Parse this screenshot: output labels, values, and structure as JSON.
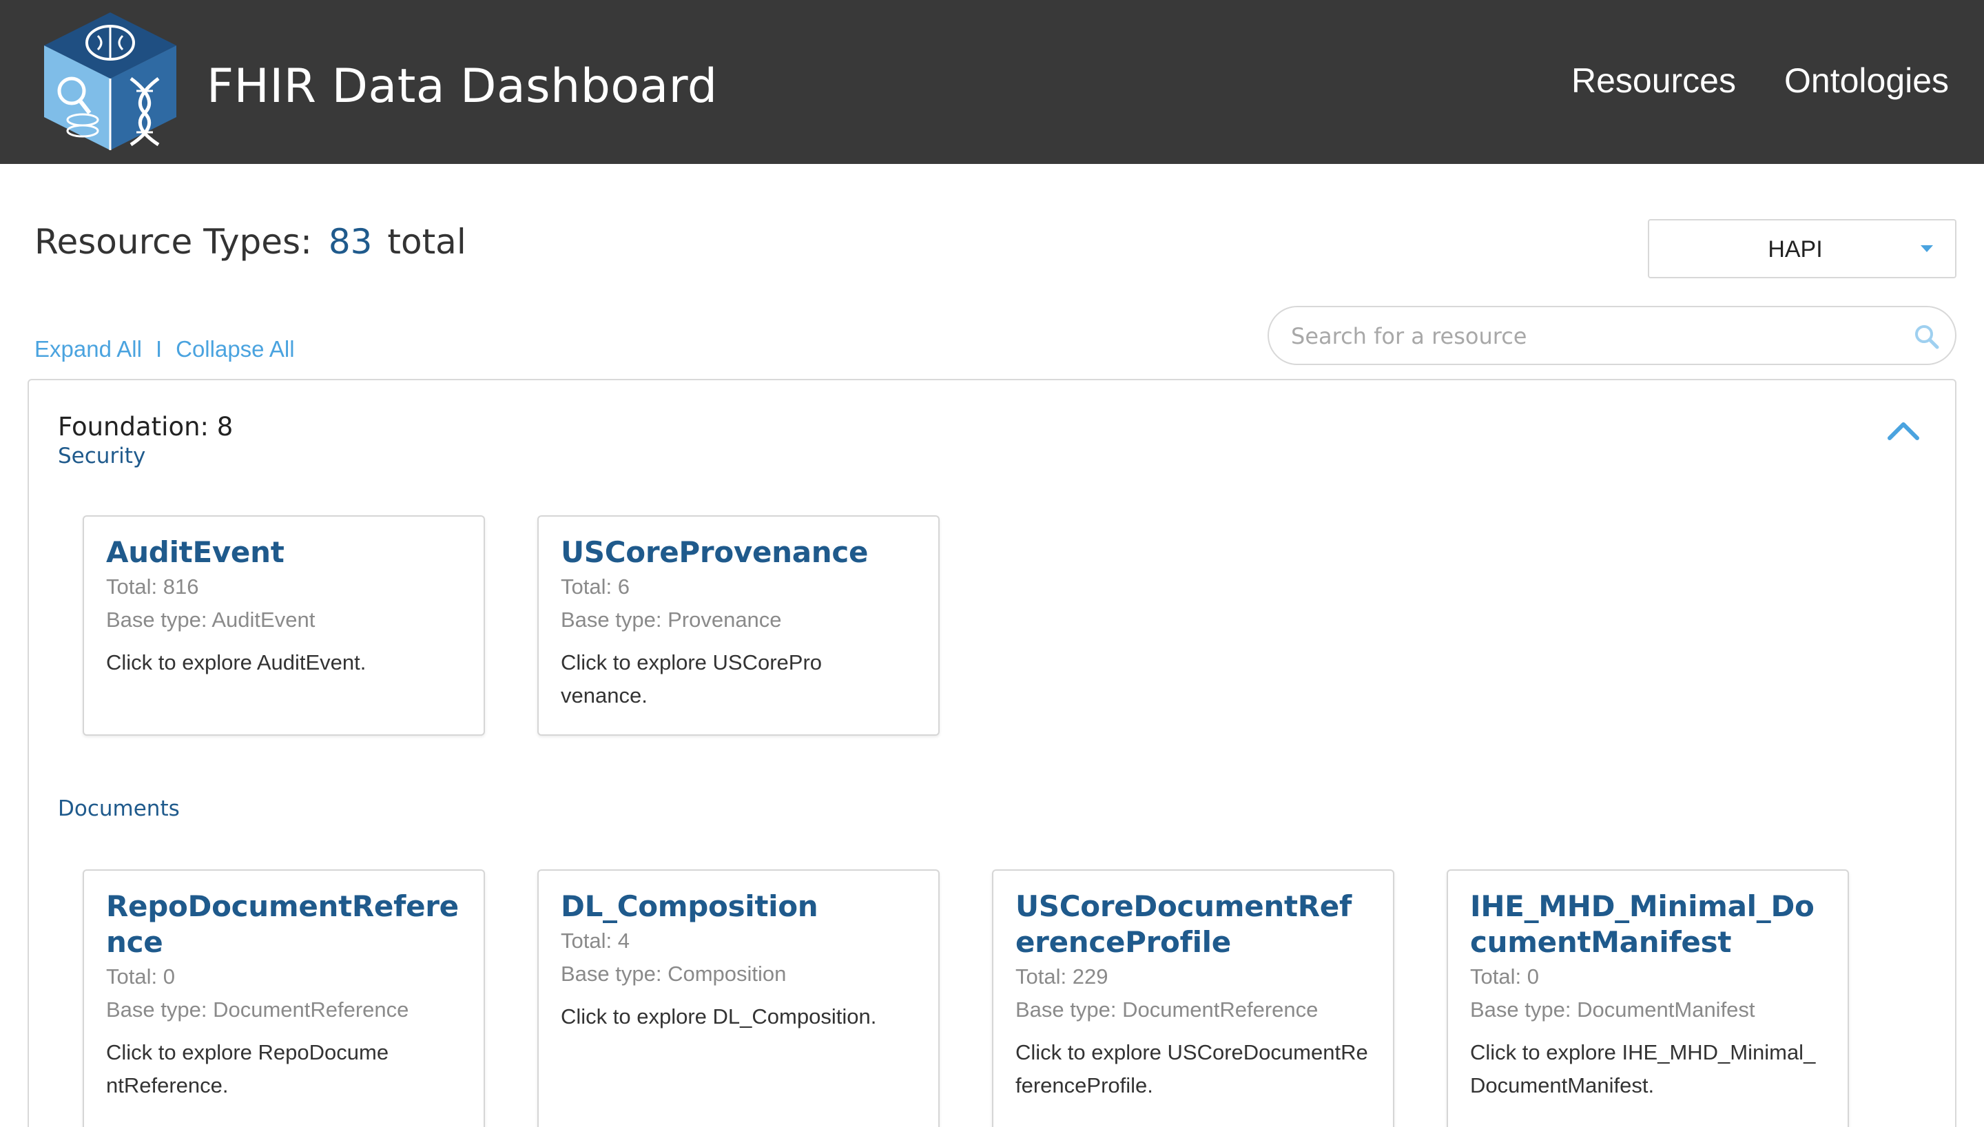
{
  "header": {
    "app_title": "FHIR Data Dashboard",
    "nav": [
      {
        "label": "Resources"
      },
      {
        "label": "Ontologies"
      }
    ]
  },
  "summary": {
    "prefix": "Resource Types:",
    "count": "83",
    "suffix": "total"
  },
  "server_select": {
    "value": "HAPI"
  },
  "controls": {
    "expand_all": "Expand All",
    "separator": "I",
    "collapse_all": "Collapse All"
  },
  "search": {
    "placeholder": "Search for a resource"
  },
  "group": {
    "title": "Foundation: 8",
    "subgroups": [
      {
        "name": "Security",
        "cards": [
          {
            "title": "AuditEvent",
            "total": "Total: 816",
            "base": "Base type: AuditEvent",
            "desc": "Click to explore AuditEvent."
          },
          {
            "title": "USCoreProvenance",
            "total": "Total: 6",
            "base": "Base type: Provenance",
            "desc": "Click to explore USCoreProvenance."
          }
        ]
      },
      {
        "name": "Documents",
        "cards": [
          {
            "title": "RepoDocumentReference",
            "total": "Total: 0",
            "base": "Base type: DocumentReference",
            "desc": "Click to explore RepoDocumentReference."
          },
          {
            "title": "DL_Composition",
            "total": "Total: 4",
            "base": "Base type: Composition",
            "desc": "Click to explore DL_Composition."
          },
          {
            "title": "USCoreDocumentReferenceProfile",
            "total": "Total: 229",
            "base": "Base type: DocumentReference",
            "desc": "Click to explore USCoreDocumentReferenceProfile."
          },
          {
            "title": "IHE_MHD_Minimal_DocumentManifest",
            "total": "Total: 0",
            "base": "Base type: DocumentManifest",
            "desc": "Click to explore IHE_MHD_Minimal_DocumentManifest."
          }
        ]
      }
    ]
  },
  "colors": {
    "header_bg": "#393939",
    "link_blue": "#4aa3df",
    "title_blue": "#1f5a8c"
  }
}
